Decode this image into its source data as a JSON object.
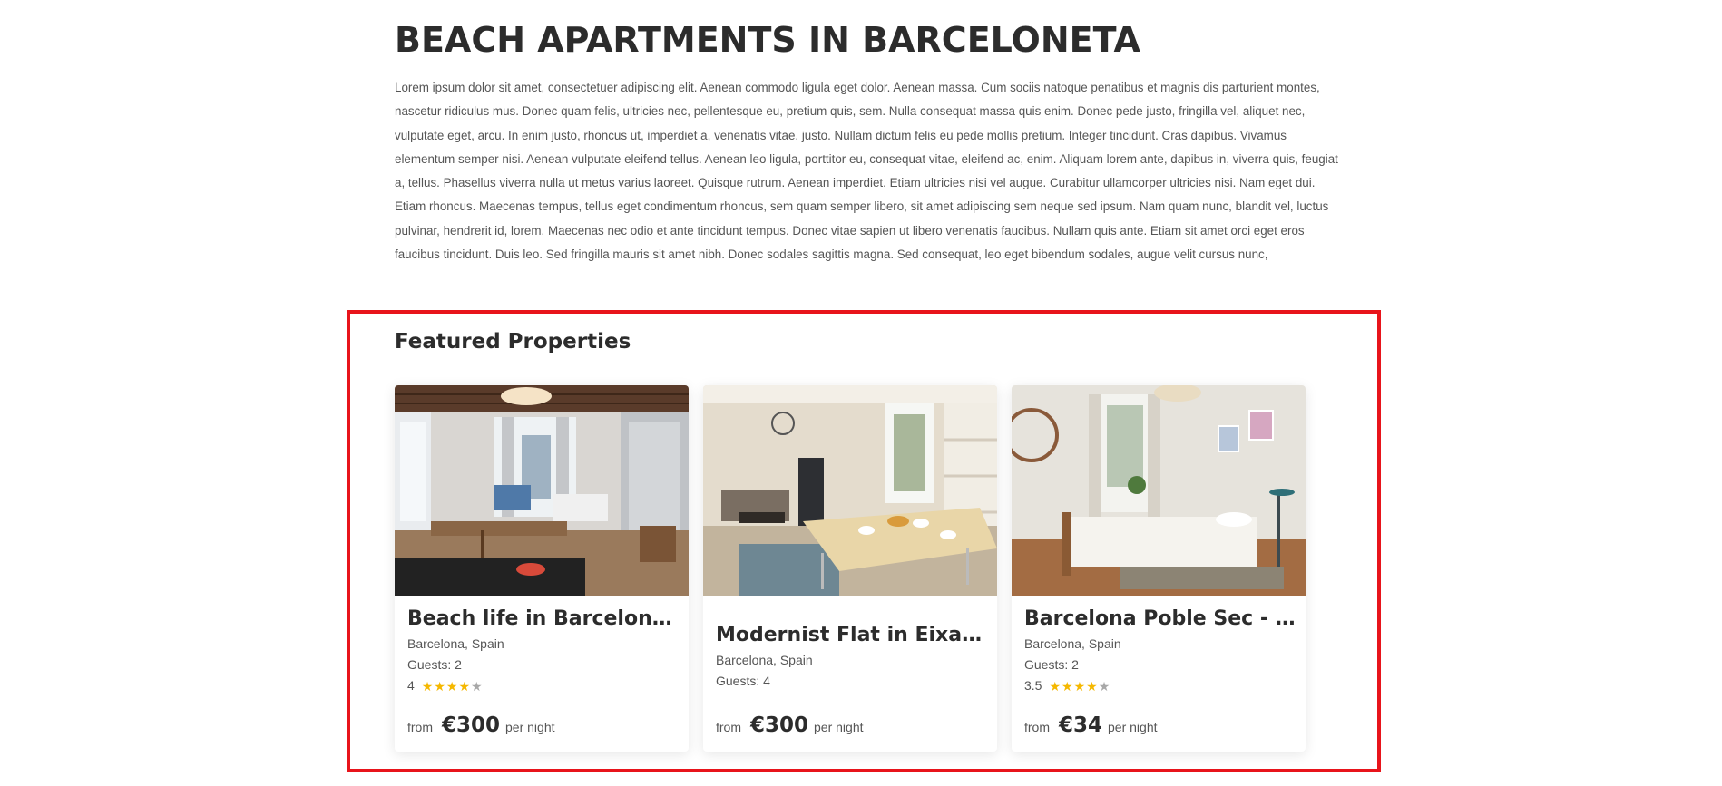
{
  "page": {
    "title": "BEACH APARTMENTS IN BARCELONETA",
    "intro": "Lorem ipsum dolor sit amet, consectetuer adipiscing elit. Aenean commodo ligula eget dolor. Aenean massa. Cum sociis natoque penatibus et magnis dis parturient montes, nascetur ridiculus mus. Donec quam felis, ultricies nec, pellentesque eu, pretium quis, sem. Nulla consequat massa quis enim. Donec pede justo, fringilla vel, aliquet nec, vulputate eget, arcu. In enim justo, rhoncus ut, imperdiet a, venenatis vitae, justo. Nullam dictum felis eu pede mollis pretium. Integer tincidunt. Cras dapibus. Vivamus elementum semper nisi. Aenean vulputate eleifend tellus. Aenean leo ligula, porttitor eu, consequat vitae, eleifend ac, enim. Aliquam lorem ante, dapibus in, viverra quis, feugiat a, tellus. Phasellus viverra nulla ut metus varius laoreet. Quisque rutrum. Aenean imperdiet. Etiam ultricies nisi vel augue. Curabitur ullamcorper ultricies nisi. Nam eget dui. Etiam rhoncus. Maecenas tempus, tellus eget condimentum rhoncus, sem quam semper libero, sit amet adipiscing sem neque sed ipsum. Nam quam nunc, blandit vel, luctus pulvinar, hendrerit id, lorem. Maecenas nec odio et ante tincidunt tempus. Donec vitae sapien ut libero venenatis faucibus. Nullam quis ante. Etiam sit amet orci eget eros faucibus tincidunt. Duis leo. Sed fringilla mauris sit amet nibh. Donec sodales sagittis magna. Sed consequat, leo eget bibendum sodales, augue velit cursus nunc,"
  },
  "featured": {
    "title": "Featured Properties",
    "highlight_color": "#e8141b",
    "star_color": "#f5b800",
    "properties": [
      {
        "name": "Beach life in Barceloneta",
        "location": "Barcelona, Spain",
        "guests": "Guests: 2",
        "rating": "4",
        "stars_filled": 4,
        "price_from": "from",
        "price": "€300",
        "price_unit": "per night"
      },
      {
        "name": "Modernist Flat in Eixample",
        "location": "Barcelona, Spain",
        "guests": "Guests: 4",
        "price_from": "from",
        "price": "€300",
        "price_unit": "per night"
      },
      {
        "name": "Barcelona Poble Sec - Ce...",
        "location": "Barcelona, Spain",
        "guests": "Guests: 2",
        "rating": "3.5",
        "stars_filled": 4,
        "price_from": "from",
        "price": "€34",
        "price_unit": "per night"
      }
    ]
  }
}
